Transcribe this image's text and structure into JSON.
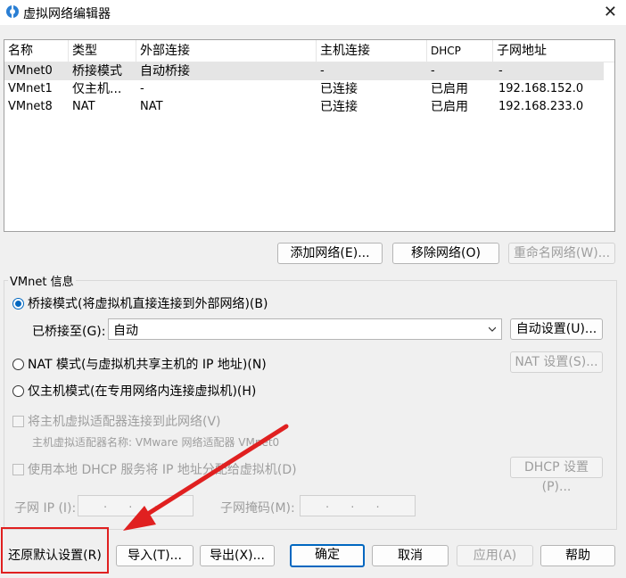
{
  "window": {
    "title": "虚拟网络编辑器",
    "close_glyph": "✕"
  },
  "list": {
    "headers": [
      "名称",
      "类型",
      "外部连接",
      "主机连接",
      "DHCP",
      "子网地址"
    ],
    "rows": [
      {
        "name": "VMnet0",
        "type": "桥接模式",
        "external": "自动桥接",
        "host": "-",
        "dhcp": "-",
        "subnet": "-"
      },
      {
        "name": "VMnet1",
        "type": "仅主机...",
        "external": "-",
        "host": "已连接",
        "dhcp": "已启用",
        "subnet": "192.168.152.0"
      },
      {
        "name": "VMnet8",
        "type": "NAT",
        "external": "NAT",
        "host": "已连接",
        "dhcp": "已启用",
        "subnet": "192.168.233.0"
      }
    ]
  },
  "list_buttons": {
    "add": "添加网络(E)...",
    "remove": "移除网络(O)",
    "rename": "重命名网络(W)..."
  },
  "vmnet_info": {
    "group_title": "VMnet 信息",
    "bridged_label": "桥接模式(将虚拟机直接连接到外部网络)(B)",
    "bridged_to_label": "已桥接至(G):",
    "bridged_to_value": "自动",
    "auto_settings": "自动设置(U)...",
    "nat_label": "NAT 模式(与虚拟机共享主机的 IP 地址)(N)",
    "nat_settings": "NAT 设置(S)...",
    "hostonly_label": "仅主机模式(在专用网络内连接虚拟机)(H)",
    "connect_adapter_label": "将主机虚拟适配器连接到此网络(V)",
    "adapter_name_label": "主机虚拟适配器名称: VMware 网络适配器 VMnet0",
    "dhcp_label": "使用本地 DHCP 服务将 IP 地址分配给虚拟机(D)",
    "dhcp_settings": "DHCP 设置(P)...",
    "subnet_ip_label": "子网 IP (I):",
    "subnet_mask_label": "子网掩码(M):",
    "ip_dots": ".  .  ."
  },
  "footer": {
    "restore_defaults": "还原默认设置(R)",
    "import": "导入(T)...",
    "export": "导出(X)...",
    "ok": "确定",
    "cancel": "取消",
    "apply": "应用(A)",
    "help": "帮助"
  },
  "colors": {
    "accent": "#0067c0",
    "annotation": "#e02020"
  },
  "icons": [
    "network-editor-icon",
    "close-icon",
    "chevron-down-icon"
  ]
}
